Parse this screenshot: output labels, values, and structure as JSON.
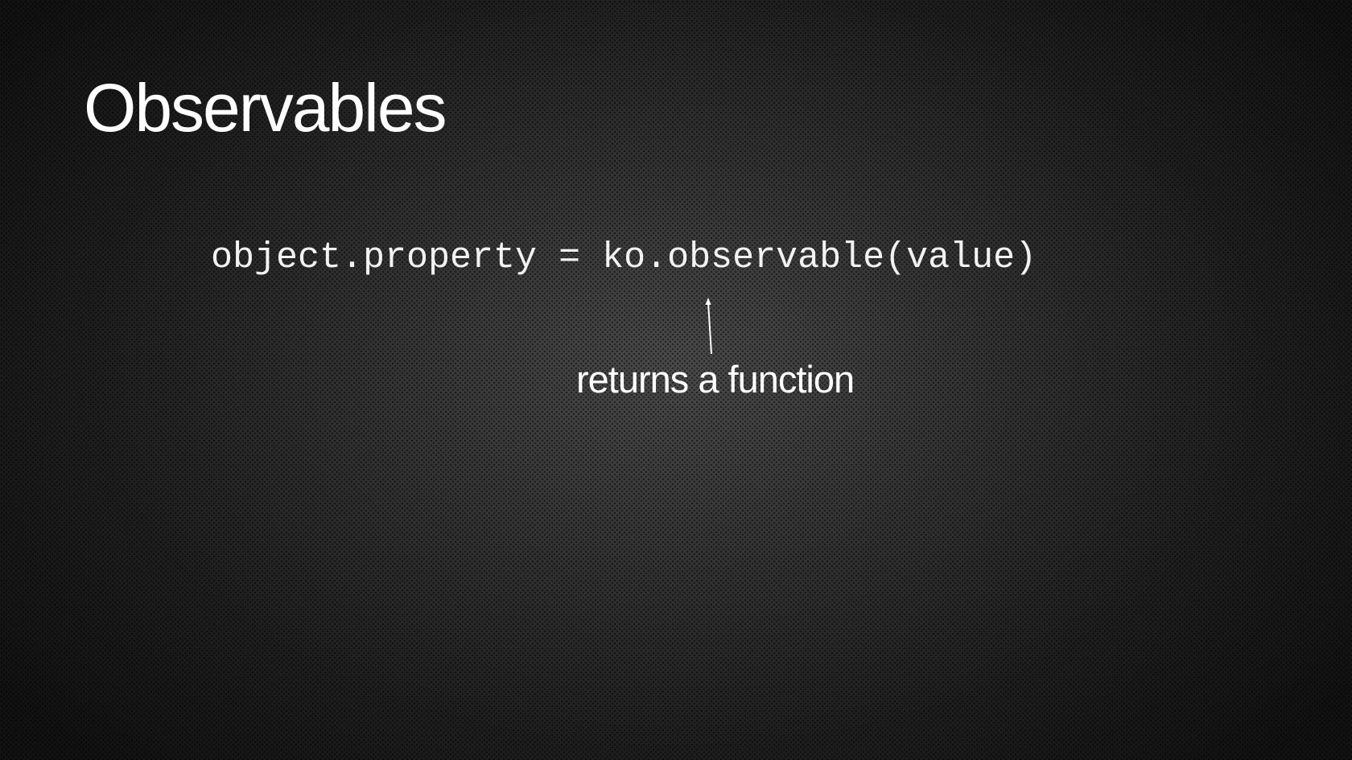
{
  "slide": {
    "title": "Observables",
    "code_line": "object.property = ko.observable(value)",
    "annotation": "returns a function",
    "pointer_icon": "arrow-up-icon"
  },
  "colors": {
    "background_center": "#4a4a4a",
    "background_edge": "#121212",
    "text": "#ffffff"
  }
}
